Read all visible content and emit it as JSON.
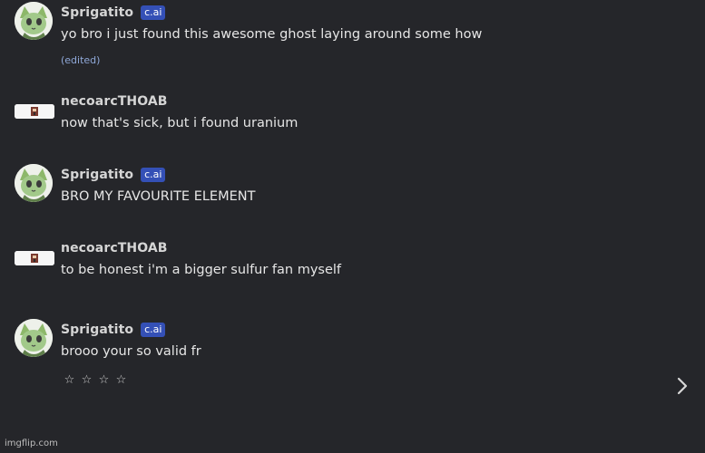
{
  "messages": [
    {
      "username": "Sprigatito",
      "badge": "c.ai",
      "text": "yo bro i just found this awesome ghost laying around some how",
      "edited": "(edited)"
    },
    {
      "username": "necoarcTHOAB",
      "text": "now that's sick, but i found uranium"
    },
    {
      "username": "Sprigatito",
      "badge": "c.ai",
      "text": "BRO MY FAVOURITE ELEMENT"
    },
    {
      "username": "necoarcTHOAB",
      "text": "to be honest i'm a bigger sulfur fan myself"
    },
    {
      "username": "Sprigatito",
      "badge": "c.ai",
      "text": "brooo your so valid fr",
      "rating": {
        "max": 4,
        "value": 0
      }
    }
  ],
  "icons": {
    "star": "star-outline-icon",
    "next": "chevron-right-icon"
  },
  "watermark": "imgflip.com"
}
